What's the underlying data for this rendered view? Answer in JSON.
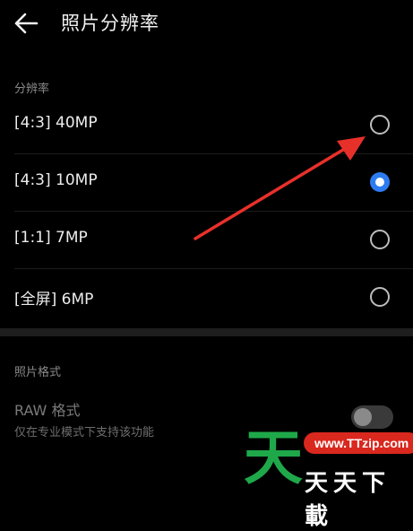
{
  "header": {
    "title": "照片分辨率",
    "back_icon": "arrow-left-icon"
  },
  "resolution_section": {
    "label": "分辨率",
    "options": [
      {
        "label": "[4:3] 40MP",
        "selected": false
      },
      {
        "label": "[4:3] 10MP",
        "selected": true
      },
      {
        "label": "[1:1] 7MP",
        "selected": false
      },
      {
        "label": "[全屏] 6MP",
        "selected": false
      }
    ]
  },
  "format_section": {
    "label": "照片格式",
    "raw_title": "RAW 格式",
    "raw_subtitle": "仅在专业模式下支持该功能",
    "raw_enabled": false
  },
  "watermark": {
    "big_char": "天",
    "url": "www.TTzip.com",
    "text": "天天下載"
  },
  "colors": {
    "accent": "#2d7bf0",
    "arrow": "#e8302a",
    "watermark_green": "#1fa84a",
    "watermark_red": "#d9281e"
  }
}
